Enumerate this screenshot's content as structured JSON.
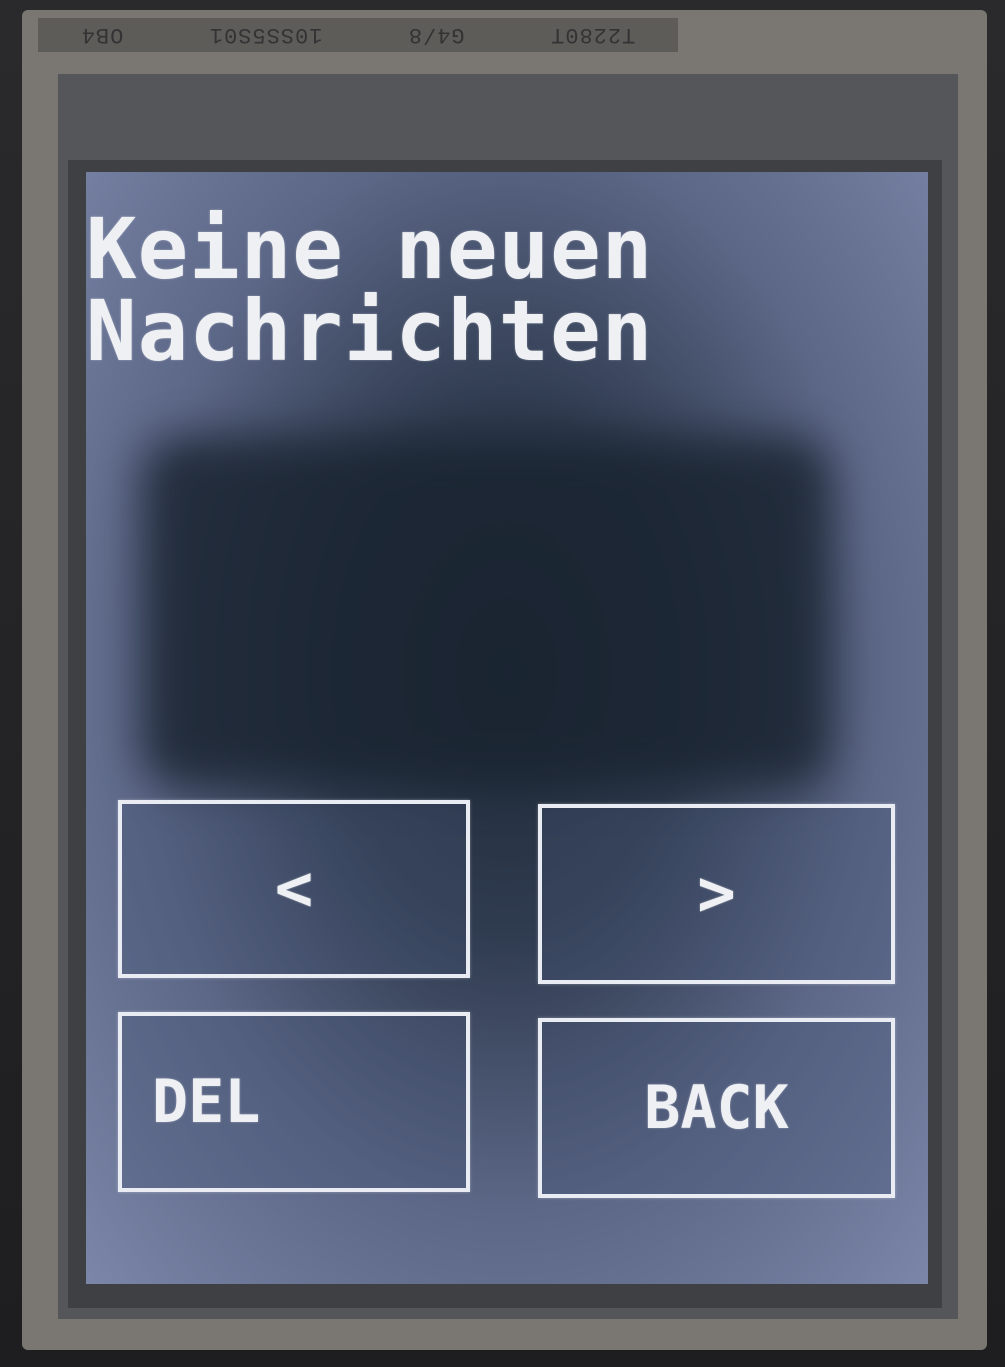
{
  "flex_cable": {
    "markings": [
      "T2280T",
      "G4/8",
      "10SS5S01",
      "OB4"
    ]
  },
  "screen": {
    "message_line1": "Keine neuen",
    "message_line2": "Nachrichten"
  },
  "buttons": {
    "prev_label": "<",
    "next_label": ">",
    "del_label": "DEL",
    "back_label": "BACK"
  },
  "colors": {
    "text": "#eef0f4",
    "button_border": "#e9ecf2",
    "screen_background": "#5c6787"
  }
}
